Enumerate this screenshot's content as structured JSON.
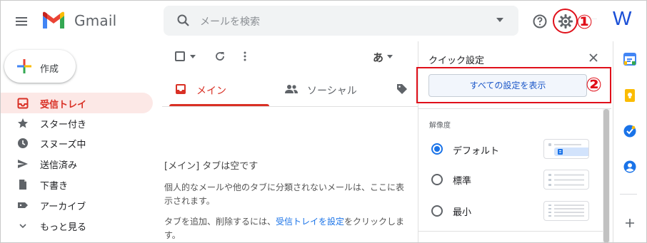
{
  "header": {
    "app_name": "Gmail",
    "search_placeholder": "メールを検索",
    "num1": "①",
    "apps_small_text": "……",
    "avatar_letter": "W"
  },
  "compose": {
    "label": "作成"
  },
  "nav": {
    "items": [
      {
        "label": "受信トレイ",
        "icon": "inbox-icon",
        "active": true
      },
      {
        "label": "スター付き",
        "icon": "star-icon"
      },
      {
        "label": "スヌーズ中",
        "icon": "clock-icon"
      },
      {
        "label": "送信済み",
        "icon": "send-icon"
      },
      {
        "label": "下書き",
        "icon": "draft-icon"
      },
      {
        "label": "アーカイブ",
        "icon": "label-icon"
      },
      {
        "label": "もっと見る",
        "icon": "chevron-down-icon"
      }
    ]
  },
  "toolbar": {
    "input_tool": "あ"
  },
  "tabs": {
    "main": "メイン",
    "social": "ソーシャル"
  },
  "empty": {
    "title": "[メイン] タブは空です",
    "body": "個人的なメールや他のタブに分類されないメールは、ここに表示されます。",
    "body2_pre": "タブを追加、削除するには、",
    "body2_link": "受信トレイを設定",
    "body2_post": "をクリックします。"
  },
  "quick_settings": {
    "title": "クイック設定",
    "all_settings_button": "すべての設定を表示",
    "num2": "②",
    "section_density": "解像度",
    "density_options": [
      {
        "label": "デフォルト",
        "selected": true
      },
      {
        "label": "標準",
        "selected": false
      },
      {
        "label": "最小",
        "selected": false
      }
    ]
  },
  "colors": {
    "accent_red": "#d93025",
    "annotation_red": "#e0101a",
    "link_blue": "#1a73e8"
  }
}
